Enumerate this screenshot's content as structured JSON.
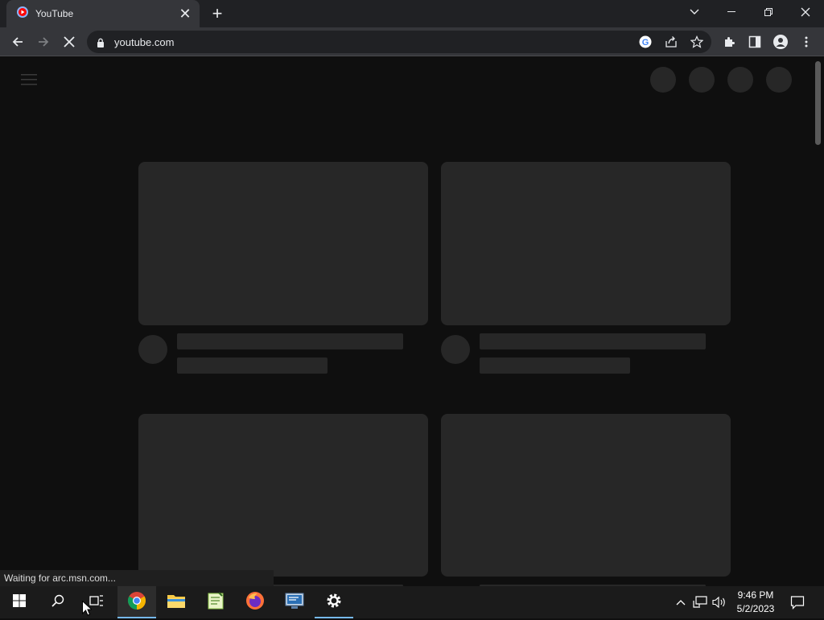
{
  "browser": {
    "tab_title": "YouTube",
    "url": "youtube.com",
    "status_text": "Waiting for arc.msn.com..."
  },
  "taskbar": {
    "apps": [
      "windows-start",
      "search",
      "task-view",
      "chrome",
      "file-explorer",
      "notepad-plus",
      "firefox",
      "remote-desktop",
      "settings"
    ],
    "clock_time": "9:46 PM",
    "clock_date": "5/2/2023"
  },
  "colors": {
    "background": "#0f0f0f",
    "skeleton": "#272727",
    "chrome_toolbar": "#35363a",
    "taskbar_accent": "#76b9ed"
  }
}
